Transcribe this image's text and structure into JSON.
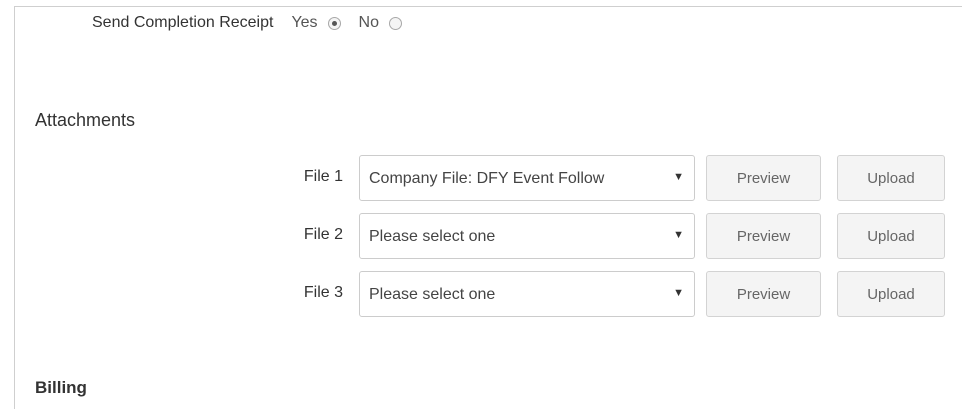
{
  "completion_receipt": {
    "label": "Send Completion Receipt",
    "options": [
      {
        "label": "Yes",
        "checked": true
      },
      {
        "label": "No",
        "checked": false
      }
    ]
  },
  "attachments": {
    "title": "Attachments",
    "files": [
      {
        "label": "File 1",
        "selected": "Company File: DFY Event Follow",
        "preview_label": "Preview",
        "upload_label": "Upload"
      },
      {
        "label": "File 2",
        "selected": "Please select one",
        "preview_label": "Preview",
        "upload_label": "Upload"
      },
      {
        "label": "File 3",
        "selected": "Please select one",
        "preview_label": "Preview",
        "upload_label": "Upload"
      }
    ],
    "caret": "▼"
  },
  "billing": {
    "title": "Billing"
  }
}
